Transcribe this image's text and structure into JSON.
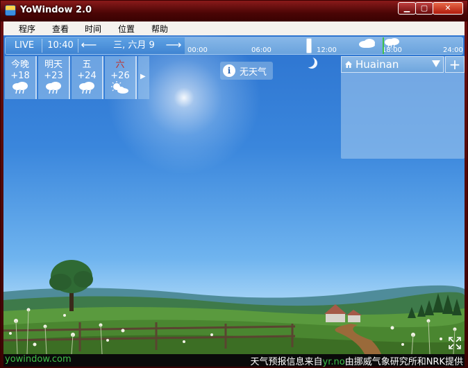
{
  "window": {
    "title": "YoWindow 2.0"
  },
  "menu": [
    "程序",
    "查看",
    "时间",
    "位置",
    "帮助"
  ],
  "topbar": {
    "live": "LIVE",
    "time": "10:40",
    "prev_arrow": "⟵",
    "next_arrow": "⟶",
    "date": "三, 六月 9",
    "timeline_ticks": [
      "00:00",
      "06:00",
      "12:00",
      "18:00",
      "24:00"
    ]
  },
  "forecast": [
    {
      "label": "今晚",
      "temp": "+18",
      "icon": "rain-cloud-icon",
      "weekend": false
    },
    {
      "label": "明天",
      "temp": "+23",
      "icon": "rain-cloud-icon",
      "weekend": false
    },
    {
      "label": "五",
      "temp": "+24",
      "icon": "rain-cloud-icon",
      "weekend": false
    },
    {
      "label": "六",
      "temp": "+26",
      "icon": "sun-cloud-icon",
      "weekend": true
    }
  ],
  "forecast_next": "▶",
  "no_weather": {
    "icon": "info-icon",
    "glyph": "i",
    "text": "无天气"
  },
  "location": {
    "name": "Huainan",
    "add": "+"
  },
  "status": {
    "site": "yowindow.com",
    "credit_pre": "天气预报信息来自",
    "credit_link": "yr.no",
    "credit_post": "由挪威气象研究所和NRK提供"
  },
  "colors": {
    "accent_green": "#3ec04a",
    "weekend_red": "#c0302a",
    "sky_top": "#2d74d0"
  }
}
